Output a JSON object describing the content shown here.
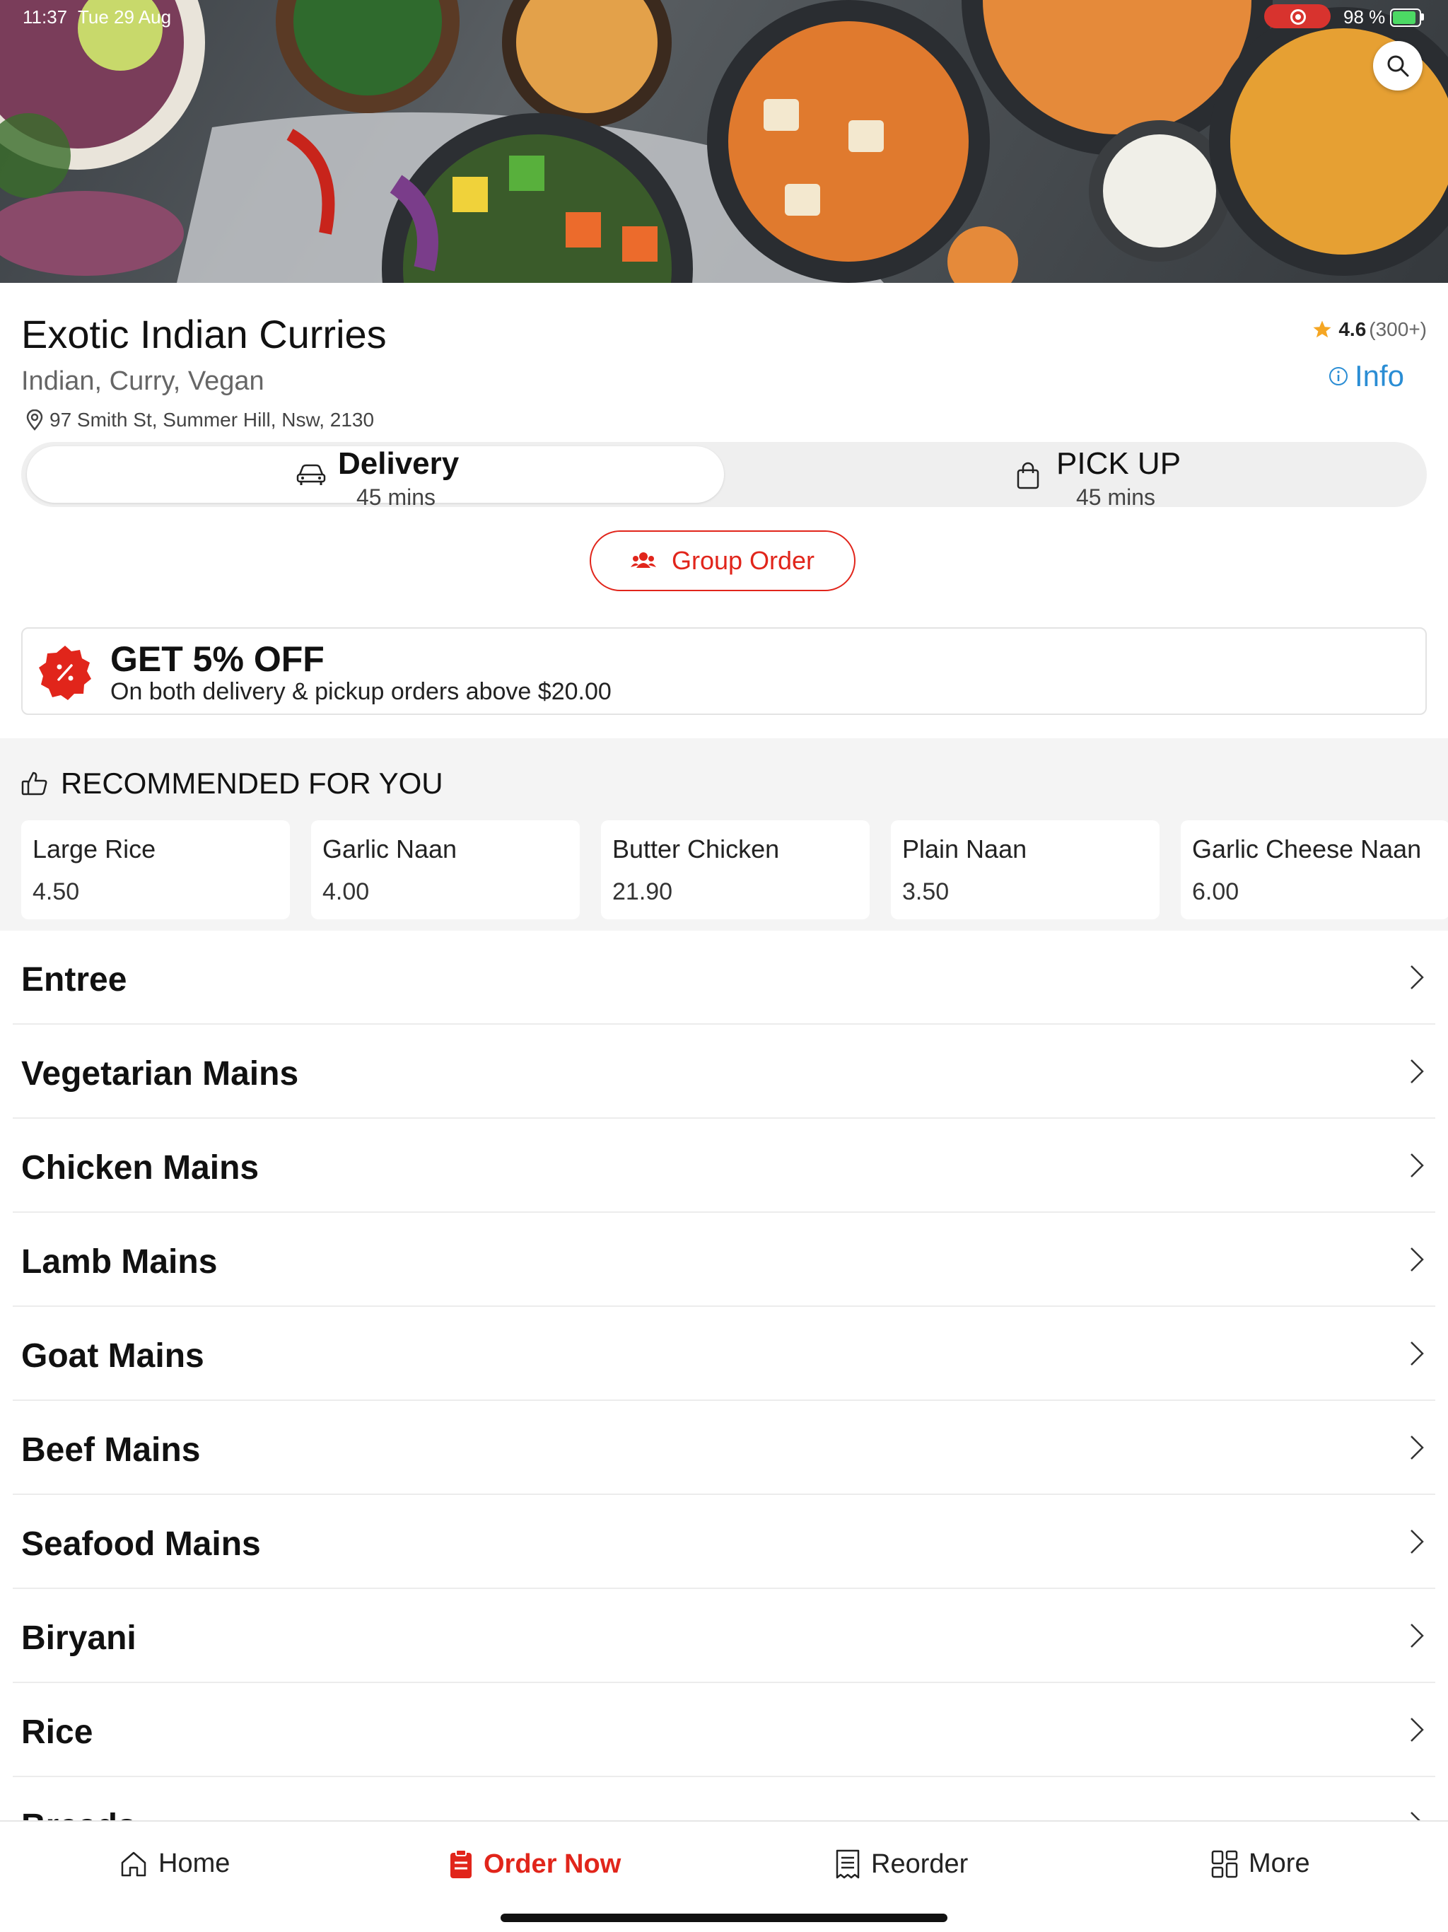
{
  "status_bar": {
    "time": "11:37",
    "date": "Tue 29 Aug",
    "battery": "98 %"
  },
  "restaurant": {
    "name": "Exotic Indian Curries",
    "cuisine": "Indian, Curry, Vegan",
    "address": "97 Smith St, Summer Hill, Nsw, 2130",
    "rating": "4.6",
    "rating_count": "(300+)",
    "info_label": "Info"
  },
  "order_mode": {
    "delivery": {
      "title": "Delivery",
      "time": "45 mins",
      "selected": true
    },
    "pickup": {
      "title": "PICK UP",
      "time": "45 mins",
      "selected": false
    }
  },
  "group_order_label": "Group Order",
  "promo": {
    "title": "GET 5% OFF",
    "subtitle": "On both delivery & pickup orders above $20.00"
  },
  "recommended": {
    "heading": "RECOMMENDED FOR YOU",
    "items": [
      {
        "name": "Large Rice",
        "price": "4.50"
      },
      {
        "name": "Garlic Naan",
        "price": "4.00"
      },
      {
        "name": "Butter Chicken",
        "price": "21.90"
      },
      {
        "name": "Plain Naan",
        "price": "3.50"
      },
      {
        "name": "Garlic Cheese Naan",
        "price": "6.00"
      }
    ]
  },
  "categories": [
    "Entree",
    "Vegetarian Mains",
    "Chicken Mains",
    "Lamb Mains",
    "Goat Mains",
    "Beef Mains",
    "Seafood Mains",
    "Biryani",
    "Rice",
    "Breads"
  ],
  "bottom_nav": {
    "home": "Home",
    "order_now": "Order Now",
    "reorder": "Reorder",
    "more": "More"
  },
  "colors": {
    "accent": "#e1251b",
    "link": "#2a8dd4",
    "star": "#f5a623"
  }
}
